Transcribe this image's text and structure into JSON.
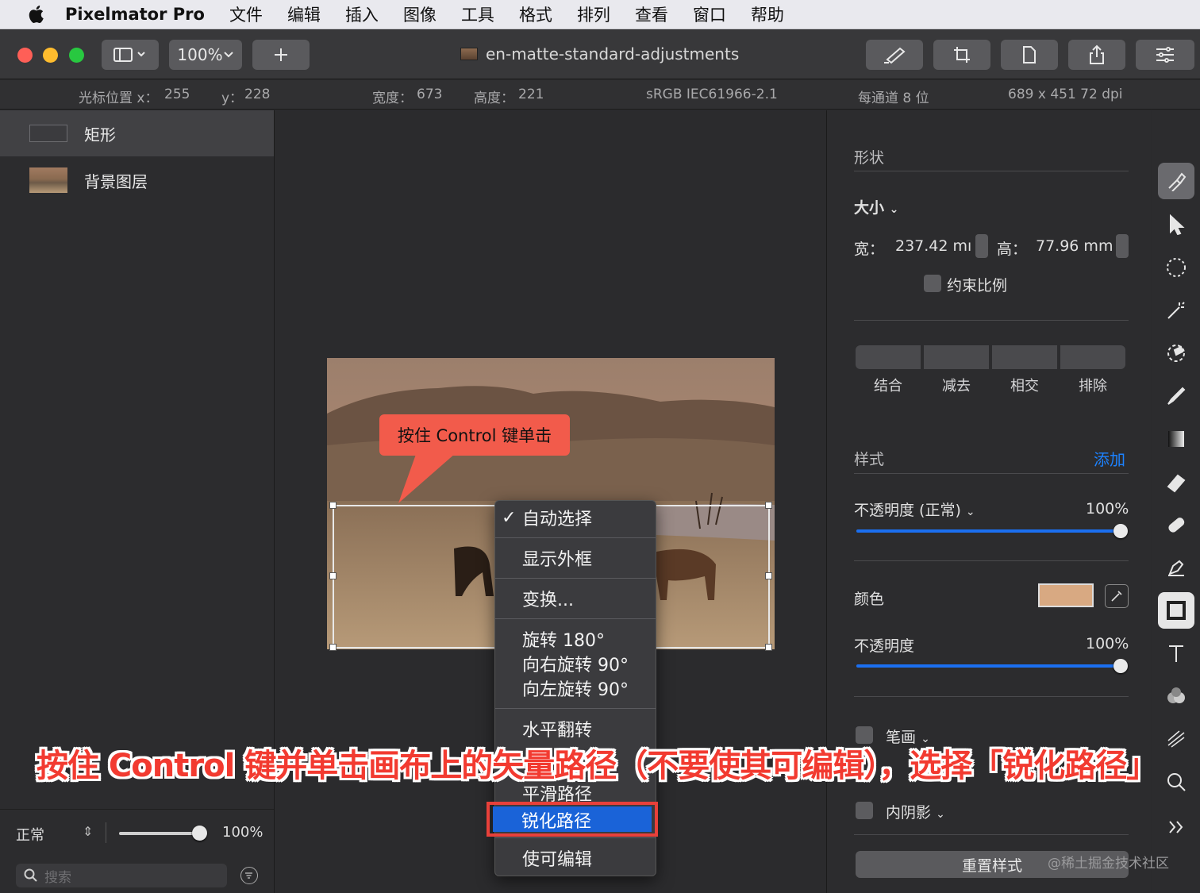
{
  "menubar": {
    "app_name": "Pixelmator Pro",
    "items": [
      "文件",
      "编辑",
      "插入",
      "图像",
      "工具",
      "格式",
      "排列",
      "查看",
      "窗口",
      "帮助"
    ]
  },
  "toolbar": {
    "zoom": "100%",
    "document_title": "en-matte-standard-adjustments"
  },
  "infobar": {
    "cursor_x_label": "光标位置 x：",
    "cursor_x": "255",
    "cursor_y_label": "y：",
    "cursor_y": "228",
    "width_label": "宽度：",
    "width": "673",
    "height_label": "高度：",
    "height": "221",
    "color_profile": "sRGB IEC61966-2.1",
    "bit_depth": "每通道 8 位",
    "image_size": "689 x 451 72 dpi"
  },
  "layers": {
    "items": [
      {
        "label": "矩形",
        "selected": true
      },
      {
        "label": "背景图层",
        "selected": false
      }
    ],
    "blend_mode": "正常",
    "opacity": "100%",
    "opacity_fraction": 1.0,
    "search_placeholder": "搜索"
  },
  "canvas": {
    "callout": "按住 Control 键单击"
  },
  "context_menu": {
    "auto_select": "自动选择",
    "show_outline": "显示外框",
    "transform": "变换...",
    "rotate_180": "旋转 180°",
    "rotate_right_90": "向右旋转 90°",
    "rotate_left_90": "向左旋转 90°",
    "flip_horizontal": "水平翻转",
    "smooth_path": "平滑路径",
    "sharpen_path": "锐化路径",
    "make_editable": "使可编辑"
  },
  "inspector": {
    "shape_heading": "形状",
    "size_label": "大小",
    "width_label": "宽：",
    "width_value": "237.42 mı",
    "height_label": "高：",
    "height_value": "77.96 mm",
    "constrain_label": "约束比例",
    "bool_ops": [
      "结合",
      "减去",
      "相交",
      "排除"
    ],
    "style_heading": "样式",
    "add_label": "添加",
    "opacity_normal_label": "不透明度 (正常)",
    "opacity_normal_value": "100%",
    "opacity_normal_fraction": 1.0,
    "color_label": "颜色",
    "color_swatch": "#d8a982",
    "fill_opacity_label": "不透明度",
    "fill_opacity_value": "100%",
    "fill_opacity_fraction": 1.0,
    "stroke_label": "笔画",
    "inner_shadow_label": "内阴影",
    "reset_label": "重置样式"
  },
  "tools": [
    "style-tool-icon",
    "arrange-tool-icon",
    "selection-tool-icon",
    "magic-wand-icon",
    "color-adjust-icon",
    "paint-icon",
    "gradient-icon",
    "eraser-icon",
    "repair-icon",
    "pen-icon",
    "shape-tool-icon",
    "type-tool-icon",
    "effects-icon",
    "distort-icon",
    "zoom-icon",
    "more-tools-icon"
  ],
  "instruction": "按住 Control 键并单击画布上的矢量路径（不要使其可编辑），选择「锐化路径」",
  "watermark": "@稀土掘金技术社区",
  "colors": {
    "accent": "#1b6ff0",
    "highlight_border": "#e8403a",
    "callout": "#f25b4b",
    "menu_highlight": "#1a63d8"
  }
}
